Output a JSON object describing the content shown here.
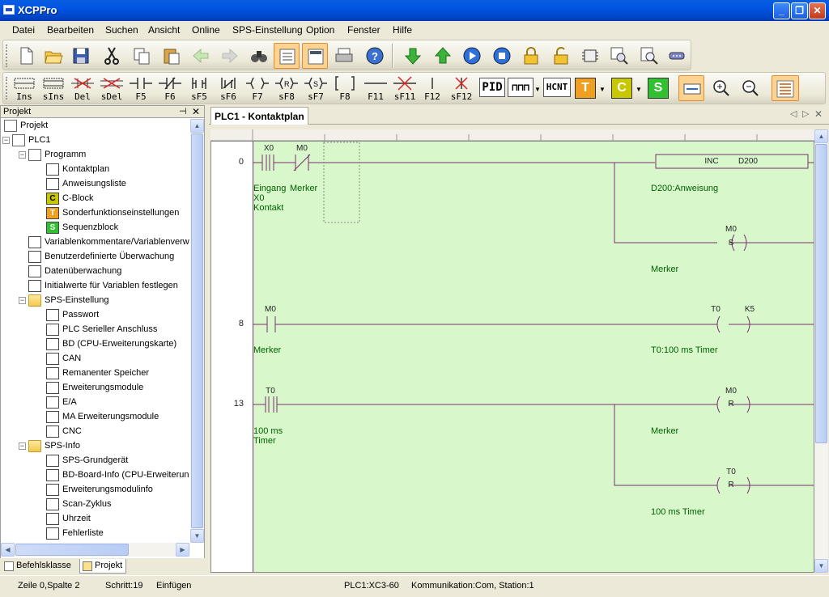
{
  "window": {
    "title": "XCPPro"
  },
  "menu": [
    "Datei",
    "Bearbeiten",
    "Suchen",
    "Ansicht",
    "Online",
    "SPS-Einstellung",
    "Option",
    "Fenster",
    "Hilfe"
  ],
  "ladder_toolbar": [
    {
      "label": "Ins"
    },
    {
      "label": "sIns"
    },
    {
      "label": "Del"
    },
    {
      "label": "sDel"
    },
    {
      "label": "F5"
    },
    {
      "label": "F6"
    },
    {
      "label": "sF5"
    },
    {
      "label": "sF6"
    },
    {
      "label": "F7"
    },
    {
      "label": "sF8"
    },
    {
      "label": "sF7"
    },
    {
      "label": "F8"
    },
    {
      "label": "F11"
    },
    {
      "label": "sF11"
    },
    {
      "label": "F12"
    },
    {
      "label": "sF12"
    }
  ],
  "ladder_toolbar_extra": {
    "pid": "PID",
    "hcnt": "HCNT",
    "t": "T",
    "c": "C",
    "s": "S"
  },
  "project_panel": {
    "title": "Projekt",
    "tree": [
      {
        "label": "Projekt",
        "icon": "project-icon"
      },
      {
        "label": "PLC1",
        "icon": "plc-icon"
      },
      {
        "label": "Programm",
        "icon": "program-icon"
      },
      {
        "label": "Kontaktplan",
        "icon": "ladder-icon"
      },
      {
        "label": "Anweisungsliste",
        "icon": "instruction-list-icon"
      },
      {
        "label": "C-Block",
        "icon": "c-block-icon"
      },
      {
        "label": "Sonderfunktionseinstellungen",
        "icon": "special-function-icon"
      },
      {
        "label": "Sequenzblock",
        "icon": "sequence-block-icon"
      },
      {
        "label": "Variablenkommentare/Variablenverw",
        "icon": "variable-comments-icon"
      },
      {
        "label": "Benutzerdefinierte Überwachung",
        "icon": "custom-monitor-icon"
      },
      {
        "label": "Datenüberwachung",
        "icon": "data-monitor-icon"
      },
      {
        "label": "Initialwerte für Variablen festlegen",
        "icon": "init-values-icon"
      },
      {
        "label": "SPS-Einstellung",
        "icon": "folder-icon"
      },
      {
        "label": "Passwort",
        "icon": "password-icon"
      },
      {
        "label": "PLC Serieller Anschluss",
        "icon": "serial-port-icon"
      },
      {
        "label": "BD (CPU-Erweiterungskarte)",
        "icon": "bd-icon"
      },
      {
        "label": "CAN",
        "icon": "can-icon"
      },
      {
        "label": "Remanenter Speicher",
        "icon": "retentive-memory-icon"
      },
      {
        "label": "Erweiterungsmodule",
        "icon": "expansion-module-icon"
      },
      {
        "label": "E/A",
        "icon": "io-icon"
      },
      {
        "label": "MA Erweiterungsmodule",
        "icon": "ma-module-icon"
      },
      {
        "label": "CNC",
        "icon": "cnc-icon"
      },
      {
        "label": "SPS-Info",
        "icon": "folder-icon"
      },
      {
        "label": "SPS-Grundgerät",
        "icon": "plc-info-icon"
      },
      {
        "label": "BD-Board-Info (CPU-Erweiterun",
        "icon": "bd-info-icon"
      },
      {
        "label": "Erweiterungsmodulinfo",
        "icon": "module-info-icon"
      },
      {
        "label": "Scan-Zyklus",
        "icon": "scan-cycle-icon"
      },
      {
        "label": "Uhrzeit",
        "icon": "clock-icon"
      },
      {
        "label": "Fehlerliste",
        "icon": "error-list-icon"
      }
    ],
    "tabs": [
      "Befehlsklasse",
      "Projekt"
    ]
  },
  "editor": {
    "tab_title": "PLC1 - Kontaktplan",
    "rungs": [
      {
        "step": "0"
      },
      {
        "step": "8"
      },
      {
        "step": "13"
      }
    ],
    "devices": {
      "x0": "X0",
      "m0_a": "M0",
      "inc": "INC",
      "d200": "D200",
      "m0_s": "M0",
      "s": "S",
      "m0_b": "M0",
      "t0_coil": "T0",
      "k5": "K5",
      "t0_contact": "T0",
      "m0_r": "M0",
      "r1": "R",
      "t0_r": "T0",
      "r2": "R"
    },
    "comments": {
      "x0_1": "Eingang",
      "x0_2": "X0",
      "x0_3": "Kontakt",
      "m0_a": "Merker",
      "d200": "D200:Anweisung",
      "m0_s": "Merker",
      "m0_b": "Merker",
      "t0_timer": "T0:100 ms Timer",
      "t0_1": "100 ms",
      "t0_2": "Timer",
      "m0_r": "Merker",
      "t0_r": "100 ms Timer"
    }
  },
  "status": {
    "position": "Zeile 0,Spalte 2",
    "steps": "Schritt:19",
    "mode": "Einfügen",
    "plc": "PLC1:XC3-60",
    "comm": "Kommunikation:Com, Station:1"
  }
}
